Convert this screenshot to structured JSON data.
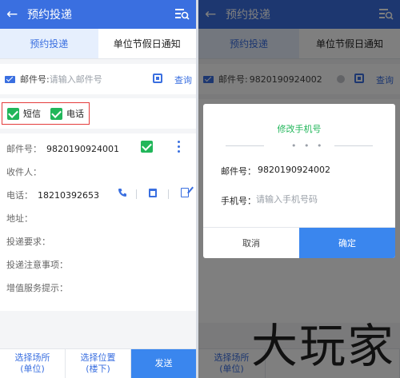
{
  "colors": {
    "primary": "#3a6fe0",
    "accent_blue": "#3a86ee",
    "check_green": "#21b65a",
    "highlight_red": "#e43b3b"
  },
  "left": {
    "header": {
      "title": "预约投递",
      "back_icon": "arrow-left",
      "menu_icon": "list-search"
    },
    "tabs": [
      {
        "label": "预约投递",
        "active": true
      },
      {
        "label": "单位节假日通知",
        "active": false
      }
    ],
    "search": {
      "label": "邮件号:",
      "placeholder": "请输入邮件号",
      "query_label": "查询"
    },
    "notify": [
      {
        "label": "短信",
        "checked": true
      },
      {
        "label": "电话",
        "checked": true
      }
    ],
    "detail": {
      "mail_no_label": "邮件号：",
      "mail_no": "9820190924001",
      "recipient_label": "收件人：",
      "phone_label": "电话：",
      "phone": "18210392653",
      "address_label": "地址：",
      "delivery_req_label": "投递要求：",
      "delivery_notes_label": "投递注意事项：",
      "value_added_label": "增值服务提示："
    },
    "bottom": {
      "location_line1": "选择场所",
      "location_line2": "(单位)",
      "position_line1": "选择位置",
      "position_line2": "(楼下)",
      "send_label": "发送"
    }
  },
  "right": {
    "header": {
      "title": "预约投递"
    },
    "tabs": [
      {
        "label": "预约投递",
        "active": true
      },
      {
        "label": "单位节假日通知",
        "active": false
      }
    ],
    "search": {
      "label": "邮件号:",
      "value": "9820190924002",
      "query_label": "查询"
    },
    "bottom": {
      "location_line1": "选择场所",
      "location_line2": "(单位)"
    },
    "dialog": {
      "title": "修改手机号",
      "mail_label": "邮件号：",
      "mail_value": "9820190924002",
      "phone_label": "手机号：",
      "phone_placeholder": "请输入手机号码",
      "cancel_label": "取消",
      "confirm_label": "确定"
    },
    "watermark": "大玩家"
  }
}
